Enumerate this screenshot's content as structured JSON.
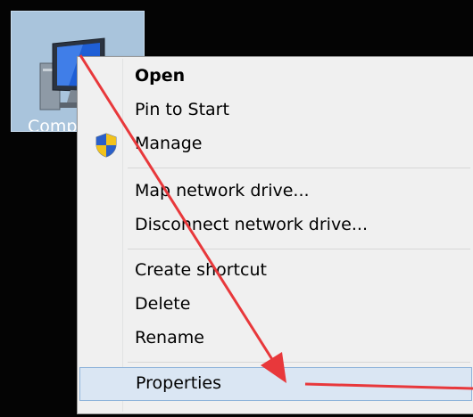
{
  "desktop": {
    "icon_label": "Comp"
  },
  "context_menu": {
    "items": [
      {
        "label": "Open"
      },
      {
        "label": "Pin to Start"
      },
      {
        "label": "Manage"
      },
      {
        "label": "Map network drive..."
      },
      {
        "label": "Disconnect network drive..."
      },
      {
        "label": "Create shortcut"
      },
      {
        "label": "Delete"
      },
      {
        "label": "Rename"
      },
      {
        "label": "Properties"
      }
    ],
    "highlighted_item": "Properties",
    "highlight_color": "#dae6f3"
  },
  "annotation": {
    "arrow_color": "#e8383b"
  }
}
